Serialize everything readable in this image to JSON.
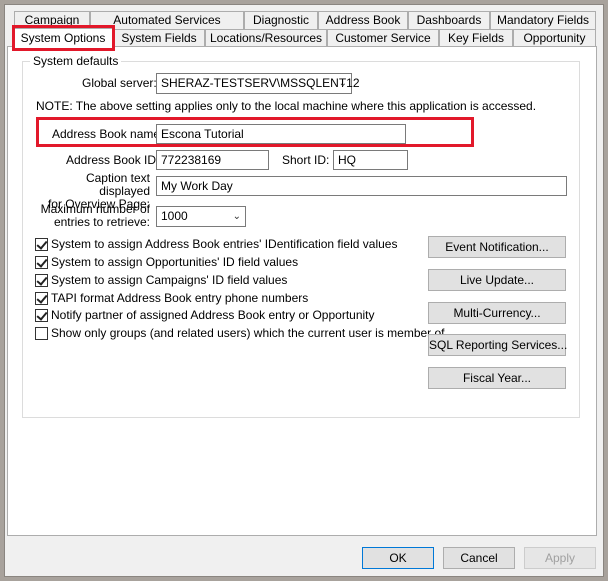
{
  "tabs_row1": [
    "Campaign",
    "Automated Services",
    "Diagnostic",
    "Address Book",
    "Dashboards",
    "Mandatory Fields"
  ],
  "tabs_row2": [
    "System Options",
    "System Fields",
    "Locations/Resources",
    "Customer Service",
    "Key Fields",
    "Opportunity"
  ],
  "group": {
    "title": "System defaults",
    "global_server_label": "Global server:",
    "global_server_value": "SHERAZ-TESTSERV\\MSSQLENT12",
    "note": "NOTE: The above setting applies only to the local machine where this application is accessed.",
    "ab_name_label": "Address Book name:",
    "ab_name_value": "Escona Tutorial",
    "ab_id_label": "Address Book ID:",
    "ab_id_value": "772238169",
    "short_id_label": "Short ID:",
    "short_id_value": "HQ",
    "caption_label_1": "Caption text displayed",
    "caption_label_2": "for Overview Page:",
    "caption_value": "My Work Day",
    "max_label_1": "Maximum number of",
    "max_label_2": "entries to retrieve:",
    "max_value": "1000"
  },
  "checkboxes": [
    {
      "label": "System to assign Address Book entries' IDentification field values",
      "checked": true
    },
    {
      "label": "System to assign Opportunities' ID field values",
      "checked": true
    },
    {
      "label": "System to assign Campaigns' ID field values",
      "checked": true
    },
    {
      "label": "TAPI format Address Book entry phone numbers",
      "checked": true
    },
    {
      "label": "Notify partner of assigned Address Book entry or Opportunity",
      "checked": true
    },
    {
      "label": "Show only groups (and related users) which the current user is member of",
      "checked": false
    }
  ],
  "side_buttons": [
    "Event Notification...",
    "Live Update...",
    "Multi-Currency...",
    "SQL Reporting Services...",
    "Fiscal Year..."
  ],
  "footer": {
    "ok": "OK",
    "cancel": "Cancel",
    "apply": "Apply"
  }
}
